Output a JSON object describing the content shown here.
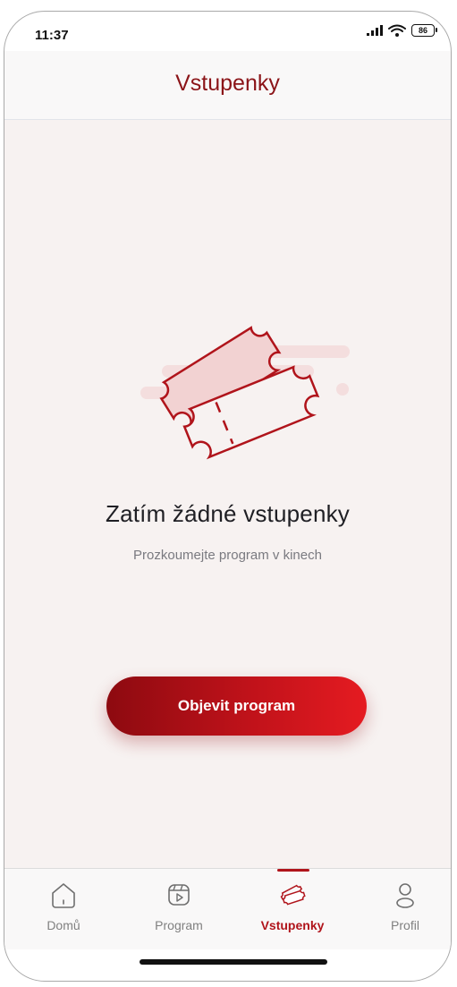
{
  "status_bar": {
    "time": "11:37",
    "battery": "86"
  },
  "header": {
    "title": "Vstupenky"
  },
  "empty_state": {
    "illustration": "tickets-illustration",
    "title": "Zatím žádné vstupenky",
    "subtitle": "Prozkoumejte program v kinech"
  },
  "cta": {
    "label": "Objevit program"
  },
  "tabs": [
    {
      "label": "Domů",
      "icon": "home-icon",
      "active": false
    },
    {
      "label": "Program",
      "icon": "calendar-play-icon",
      "active": false
    },
    {
      "label": "Vstupenky",
      "icon": "ticket-icon",
      "active": true
    },
    {
      "label": "Profil",
      "icon": "profile-icon",
      "active": false
    }
  ],
  "colors": {
    "accent": "#b0141b",
    "title": "#8b1418",
    "background": "#f7f2f1"
  }
}
